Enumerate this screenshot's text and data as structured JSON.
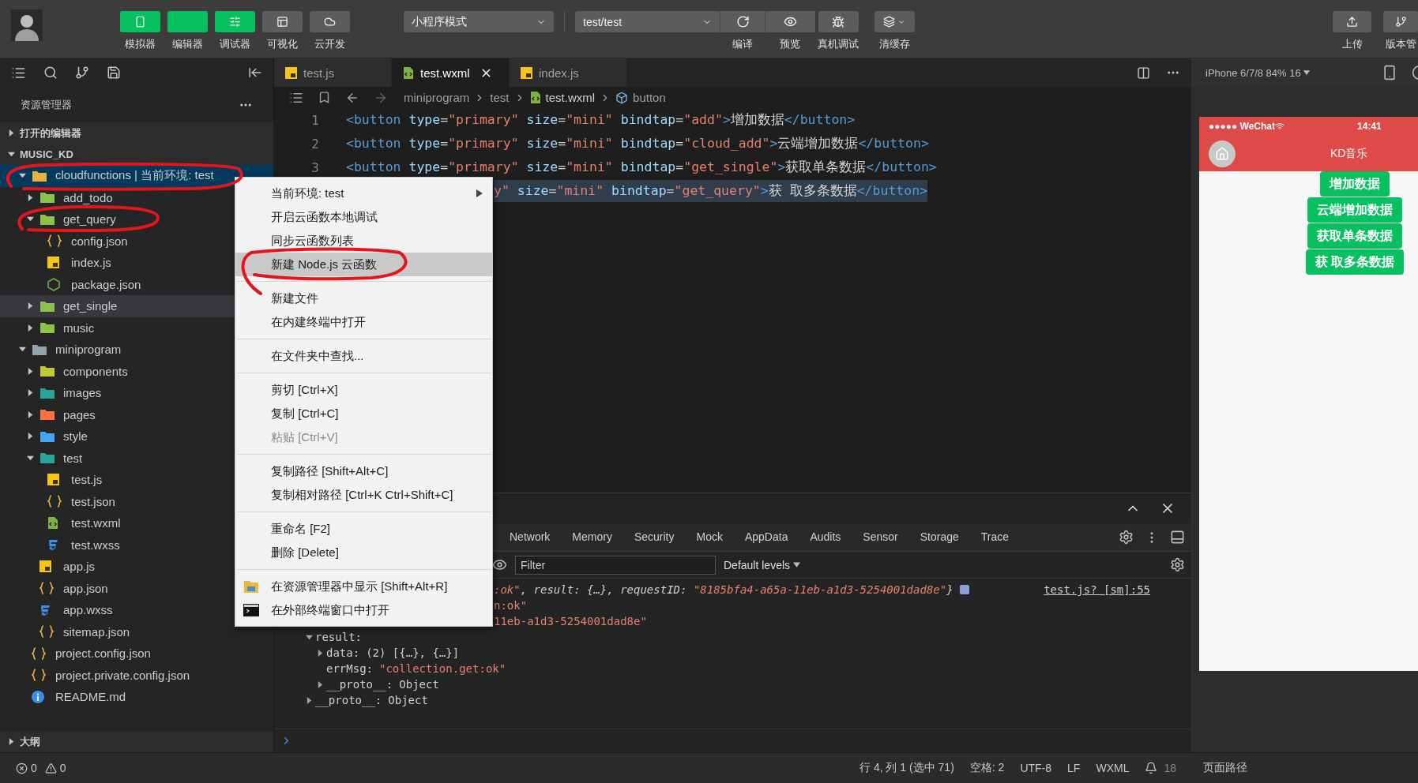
{
  "toolbar": {
    "modes": [
      {
        "label": "模拟器",
        "selected": true
      },
      {
        "label": "编辑器",
        "selected": true
      },
      {
        "label": "调试器",
        "selected": true
      },
      {
        "label": "可视化",
        "selected": false
      },
      {
        "label": "云开发",
        "selected": false
      }
    ],
    "mode_select": "小程序模式",
    "compile_select": "test/test",
    "compile_actions": [
      {
        "label": "编译"
      },
      {
        "label": "预览"
      }
    ],
    "tools": [
      {
        "label": "真机调试"
      },
      {
        "label": "清缓存"
      }
    ],
    "right_actions": [
      {
        "label": "上传"
      },
      {
        "label": "版本管"
      }
    ]
  },
  "sidebar": {
    "title": "资源管理器",
    "sections": [
      {
        "label": "打开的编辑器",
        "expanded": false
      },
      {
        "label": "MUSIC_KD",
        "expanded": true,
        "tree": [
          {
            "name": "cloudfunctions | 当前环境: test",
            "kind": "folder",
            "color": "#e8b33c",
            "expanded": true,
            "selected": true,
            "hover": false,
            "children": [
              {
                "name": "add_todo",
                "kind": "folder",
                "color": "#8bc34a",
                "expanded": false,
                "selected": false,
                "hover": false
              },
              {
                "name": "get_query",
                "kind": "folder",
                "color": "#8bc34a",
                "expanded": true,
                "selected": false,
                "hover": false,
                "children": [
                  {
                    "name": "config.json",
                    "kind": "json",
                    "selected": false,
                    "hover": false
                  },
                  {
                    "name": "index.js",
                    "kind": "js",
                    "selected": false,
                    "hover": false
                  },
                  {
                    "name": "package.json",
                    "kind": "npm",
                    "selected": false,
                    "hover": false
                  }
                ]
              },
              {
                "name": "get_single",
                "kind": "folder",
                "color": "#8bc34a",
                "expanded": false,
                "selected": false,
                "hover": true
              },
              {
                "name": "music",
                "kind": "folder",
                "color": "#8bc34a",
                "expanded": false,
                "selected": false,
                "hover": false
              }
            ]
          },
          {
            "name": "miniprogram",
            "kind": "folder",
            "color": "#90a4ae",
            "expanded": true,
            "selected": false,
            "hover": false,
            "children": [
              {
                "name": "components",
                "kind": "folder",
                "color": "#c0ca33",
                "expanded": false,
                "selected": false,
                "hover": false
              },
              {
                "name": "images",
                "kind": "folder",
                "color": "#26a69a",
                "expanded": false,
                "selected": false,
                "hover": false
              },
              {
                "name": "pages",
                "kind": "folder",
                "color": "#ff7043",
                "expanded": false,
                "selected": false,
                "hover": false
              },
              {
                "name": "style",
                "kind": "folder",
                "color": "#42a5f5",
                "expanded": false,
                "selected": false,
                "hover": false
              },
              {
                "name": "test",
                "kind": "folder",
                "color": "#26a69a",
                "expanded": true,
                "selected": false,
                "hover": false,
                "children": [
                  {
                    "name": "test.js",
                    "kind": "js",
                    "selected": false,
                    "hover": false
                  },
                  {
                    "name": "test.json",
                    "kind": "json",
                    "selected": false,
                    "hover": false
                  },
                  {
                    "name": "test.wxml",
                    "kind": "wxml",
                    "selected": false,
                    "hover": false
                  },
                  {
                    "name": "test.wxss",
                    "kind": "wxss",
                    "selected": false,
                    "hover": false
                  }
                ]
              },
              {
                "name": "app.js",
                "kind": "js",
                "selected": false,
                "hover": false
              },
              {
                "name": "app.json",
                "kind": "json",
                "selected": false,
                "hover": false
              },
              {
                "name": "app.wxss",
                "kind": "wxss",
                "selected": false,
                "hover": false
              },
              {
                "name": "sitemap.json",
                "kind": "json",
                "selected": false,
                "hover": false
              }
            ]
          },
          {
            "name": "project.config.json",
            "kind": "json",
            "selected": false,
            "hover": false
          },
          {
            "name": "project.private.config.json",
            "kind": "json",
            "selected": false,
            "hover": false
          },
          {
            "name": "README.md",
            "kind": "md",
            "selected": false,
            "hover": false
          }
        ]
      }
    ],
    "footer_section": {
      "label": "大纲",
      "expanded": false
    }
  },
  "editor": {
    "tabs": [
      {
        "label": "test.js",
        "kind": "js",
        "selected": false
      },
      {
        "label": "test.wxml",
        "kind": "wxml",
        "selected": true
      },
      {
        "label": "index.js",
        "kind": "js",
        "selected": false
      }
    ],
    "breadcrumb": [
      {
        "label": "miniprogram",
        "kind": "folder"
      },
      {
        "label": "test",
        "kind": "folder"
      },
      {
        "label": "test.wxml",
        "kind": "wxml"
      },
      {
        "label": "button",
        "kind": "element"
      }
    ],
    "lines": [
      {
        "number": "1",
        "selected": false,
        "tokens": [
          {
            "text": "<button",
            "kind": "tag"
          },
          {
            "text": " type",
            "kind": "attr"
          },
          {
            "text": "=",
            "kind": "punct"
          },
          {
            "text": "\"primary\"",
            "kind": "string"
          },
          {
            "text": " size",
            "kind": "attr"
          },
          {
            "text": "=",
            "kind": "punct"
          },
          {
            "text": "\"mini\"",
            "kind": "string"
          },
          {
            "text": " bindtap",
            "kind": "attr"
          },
          {
            "text": "=",
            "kind": "punct"
          },
          {
            "text": "\"add\"",
            "kind": "string"
          },
          {
            "text": ">",
            "kind": "tag"
          },
          {
            "text": "增加数据",
            "kind": "text"
          },
          {
            "text": "</button>",
            "kind": "tag"
          }
        ]
      },
      {
        "number": "2",
        "selected": false,
        "tokens": [
          {
            "text": "<button",
            "kind": "tag"
          },
          {
            "text": " type",
            "kind": "attr"
          },
          {
            "text": "=",
            "kind": "punct"
          },
          {
            "text": "\"primary\"",
            "kind": "string"
          },
          {
            "text": " size",
            "kind": "attr"
          },
          {
            "text": "=",
            "kind": "punct"
          },
          {
            "text": "\"mini\"",
            "kind": "string"
          },
          {
            "text": " bindtap",
            "kind": "attr"
          },
          {
            "text": "=",
            "kind": "punct"
          },
          {
            "text": "\"cloud_add\"",
            "kind": "string"
          },
          {
            "text": ">",
            "kind": "tag"
          },
          {
            "text": "云端增加数据",
            "kind": "text"
          },
          {
            "text": "</button>",
            "kind": "tag"
          }
        ]
      },
      {
        "number": "3",
        "selected": false,
        "tokens": [
          {
            "text": "<button",
            "kind": "tag"
          },
          {
            "text": " type",
            "kind": "attr"
          },
          {
            "text": "=",
            "kind": "punct"
          },
          {
            "text": "\"primary\"",
            "kind": "string"
          },
          {
            "text": " size",
            "kind": "attr"
          },
          {
            "text": "=",
            "kind": "punct"
          },
          {
            "text": "\"mini\"",
            "kind": "string"
          },
          {
            "text": " bindtap",
            "kind": "attr"
          },
          {
            "text": "=",
            "kind": "punct"
          },
          {
            "text": "\"get_single\"",
            "kind": "string"
          },
          {
            "text": ">",
            "kind": "tag"
          },
          {
            "text": "获取单条数据",
            "kind": "text"
          },
          {
            "text": "</button>",
            "kind": "tag"
          }
        ]
      },
      {
        "selected": true,
        "tokens": [
          {
            "text": "y\"",
            "kind": "string"
          },
          {
            "text": " size",
            "kind": "attr"
          },
          {
            "text": "=",
            "kind": "punct"
          },
          {
            "text": "\"mini\"",
            "kind": "string"
          },
          {
            "text": " bindtap",
            "kind": "attr"
          },
          {
            "text": "=",
            "kind": "punct"
          },
          {
            "text": "\"get_query\"",
            "kind": "string"
          },
          {
            "text": ">",
            "kind": "tag"
          },
          {
            "text": "获 取多条数据",
            "kind": "text"
          },
          {
            "text": "</button>",
            "kind": "tag"
          }
        ]
      }
    ]
  },
  "panel": {
    "tabs": [
      {
        "label": "Network",
        "selected": false
      },
      {
        "label": "Memory",
        "selected": false
      },
      {
        "label": "Security",
        "selected": false
      },
      {
        "label": "Mock",
        "selected": false
      },
      {
        "label": "AppData",
        "selected": false
      },
      {
        "label": "Audits",
        "selected": false
      },
      {
        "label": "Sensor",
        "selected": false
      },
      {
        "label": "Storage",
        "selected": false
      },
      {
        "label": "Trace",
        "selected": false
      }
    ],
    "filter": {
      "placeholder": "Filter"
    },
    "levels": "Default levels",
    "log": {
      "summary": {
        "tokens": [
          {
            "text": ":ok\"",
            "kind": "string"
          },
          {
            "text": ", result: {…}, requestID: ",
            "kind": "plain"
          },
          {
            "text": "\"8185bfa4-a65a-11eb-a1d3-5254001dad8e\"",
            "kind": "string"
          },
          {
            "text": "}",
            "kind": "plain"
          }
        ],
        "source": "test.js? [sm]:55"
      },
      "entries": [
        {
          "kind": "covered",
          "tokens": [
            {
              "text": "n:ok\"",
              "kind": "string"
            }
          ]
        },
        {
          "kind": "covered",
          "tokens": [
            {
              "text": "11eb-a1d3-5254001dad8e\"",
              "kind": "string"
            }
          ]
        },
        {
          "kind": "object",
          "key": "result:",
          "expanded": true,
          "children": [
            {
              "kind": "object",
              "key": "data:",
              "value": {
                "text": "(2) [{…}, {…}]",
                "kind": "plain"
              },
              "expanded": false
            },
            {
              "kind": "leaf",
              "key": "errMsg:",
              "value": {
                "text": "\"collection.get:ok\"",
                "kind": "string"
              }
            },
            {
              "kind": "object",
              "key": "__proto__:",
              "value": {
                "text": "Object",
                "kind": "plain"
              },
              "expanded": false
            }
          ]
        },
        {
          "kind": "object",
          "key": "__proto__:",
          "value": {
            "text": "Object",
            "kind": "plain"
          },
          "expanded": false
        }
      ]
    }
  },
  "context_menu": {
    "groups": [
      {
        "items": [
          {
            "label": "当前环境: test",
            "kind": "plain",
            "submenu": true,
            "selected": false,
            "disabled": false
          },
          {
            "label": "开启云函数本地调试",
            "kind": "plain",
            "submenu": false,
            "selected": false,
            "disabled": false
          },
          {
            "label": "同步云函数列表",
            "kind": "plain",
            "submenu": false,
            "selected": false,
            "disabled": false
          },
          {
            "label": "新建 Node.js 云函数",
            "kind": "plain",
            "submenu": false,
            "selected": true,
            "disabled": false
          }
        ]
      },
      {
        "items": [
          {
            "label": "新建文件",
            "kind": "plain",
            "submenu": false,
            "selected": false,
            "disabled": false
          },
          {
            "label": "在内建终端中打开",
            "kind": "plain",
            "submenu": false,
            "selected": false,
            "disabled": false
          }
        ]
      },
      {
        "items": [
          {
            "label": "在文件夹中查找...",
            "kind": "plain",
            "submenu": false,
            "selected": false,
            "disabled": false
          }
        ]
      },
      {
        "items": [
          {
            "label": "剪切",
            "shortcut": "[Ctrl+X]",
            "kind": "plain",
            "submenu": false,
            "selected": false,
            "disabled": false
          },
          {
            "label": "复制",
            "shortcut": "[Ctrl+C]",
            "kind": "plain",
            "submenu": false,
            "selected": false,
            "disabled": false
          },
          {
            "label": "粘贴",
            "shortcut": "[Ctrl+V]",
            "kind": "plain",
            "submenu": false,
            "selected": false,
            "disabled": true
          }
        ]
      },
      {
        "items": [
          {
            "label": "复制路径",
            "shortcut": "[Shift+Alt+C]",
            "kind": "plain",
            "submenu": false,
            "selected": false,
            "disabled": false
          },
          {
            "label": "复制相对路径",
            "shortcut": "[Ctrl+K Ctrl+Shift+C]",
            "kind": "plain",
            "submenu": false,
            "selected": false,
            "disabled": false
          }
        ]
      },
      {
        "items": [
          {
            "label": "重命名",
            "shortcut": "[F2]",
            "kind": "plain",
            "submenu": false,
            "selected": false,
            "disabled": false
          },
          {
            "label": "删除",
            "shortcut": "[Delete]",
            "kind": "plain",
            "submenu": false,
            "selected": false,
            "disabled": false
          }
        ]
      },
      {
        "items": [
          {
            "label": "在资源管理器中显示",
            "shortcut": "[Shift+Alt+R]",
            "kind": "explorer",
            "submenu": false,
            "selected": false,
            "disabled": false
          },
          {
            "label": "在外部终端窗口中打开",
            "kind": "terminal",
            "submenu": false,
            "selected": false,
            "disabled": false
          }
        ]
      }
    ]
  },
  "simulator": {
    "device": "iPhone 6/7/8 84% 16",
    "phone": {
      "carrier": "●●●●● WeChat",
      "time": "14:41",
      "title": "KD音乐",
      "buttons": [
        "增加数据",
        "云端增加数据",
        "获取单条数据",
        "获 取多条数据"
      ]
    }
  },
  "status_bar": {
    "errors": "0",
    "warnings": "0",
    "items": [
      "行 4, 列 1 (选中 71)",
      "空格: 2",
      "UTF-8",
      "LF",
      "WXML"
    ],
    "notifications": "18",
    "page_path": "页面路径"
  }
}
